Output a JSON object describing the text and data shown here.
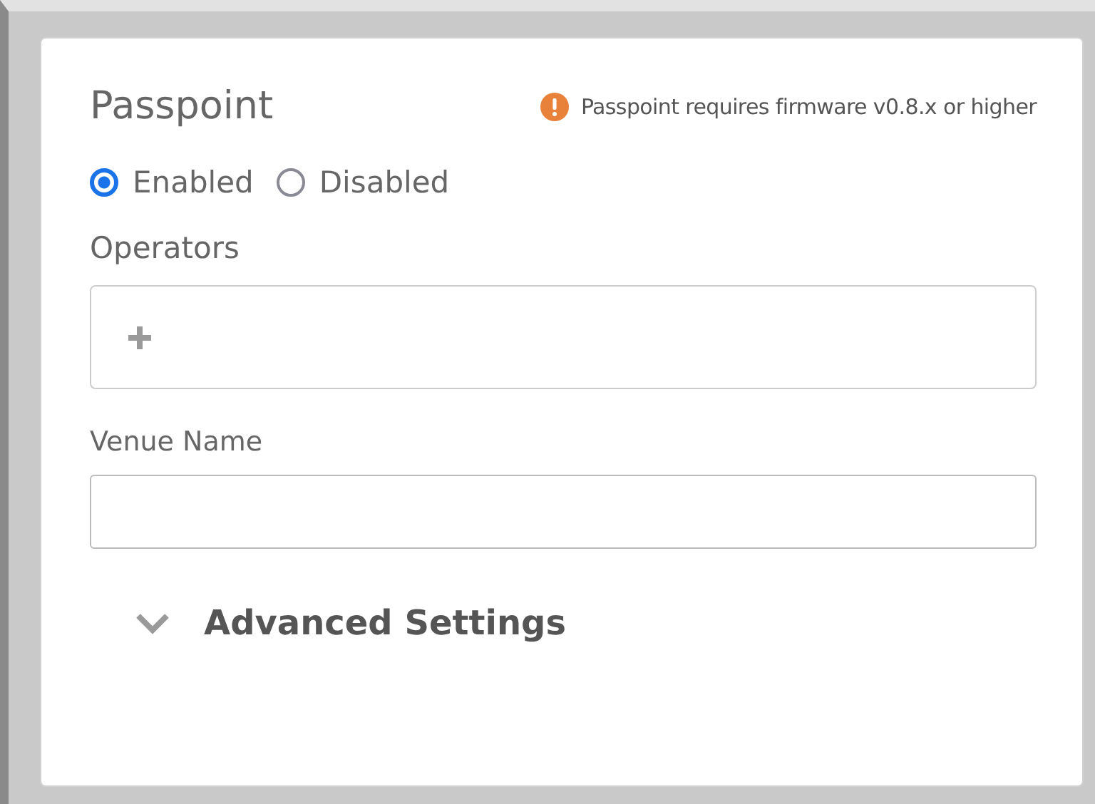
{
  "section": {
    "title": "Passpoint",
    "notice": "Passpoint requires firmware v0.8.x or higher"
  },
  "mode_options": [
    {
      "label": "Enabled",
      "selected": true
    },
    {
      "label": "Disabled",
      "selected": false
    }
  ],
  "operators": {
    "label": "Operators"
  },
  "venue_name": {
    "label": "Venue Name"
  },
  "advanced_settings": {
    "label": "Advanced Settings",
    "expanded": false
  }
}
